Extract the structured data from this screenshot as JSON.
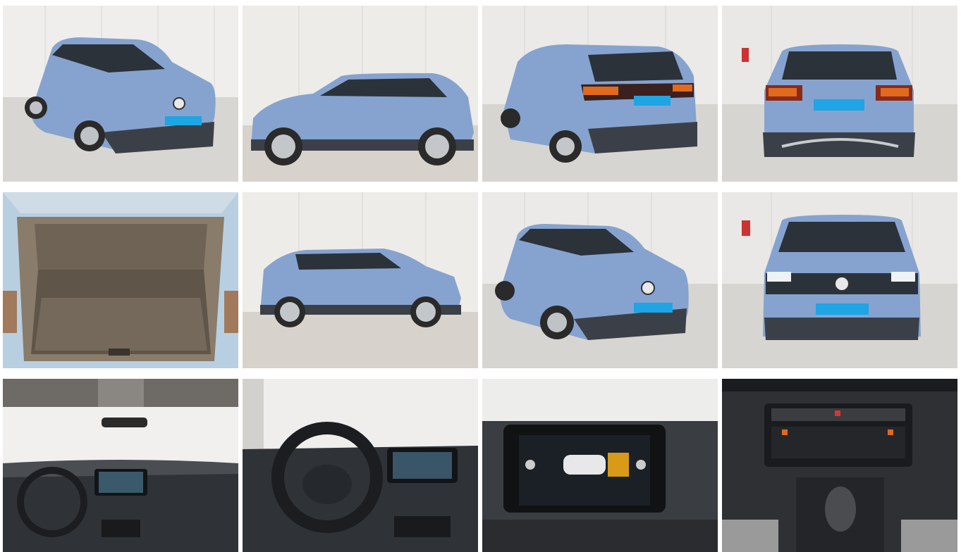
{
  "gallery": {
    "car_color": "#86a3cf",
    "car_dark": "#3b4048",
    "accent_blue": "#1ea5e3",
    "photos": [
      {
        "name": "photo-front-left-three-quarter"
      },
      {
        "name": "photo-side-profile-left"
      },
      {
        "name": "photo-rear-left-three-quarter"
      },
      {
        "name": "photo-rear"
      },
      {
        "name": "photo-trunk-open"
      },
      {
        "name": "photo-side-profile-right"
      },
      {
        "name": "photo-front-left-three-quarter-2"
      },
      {
        "name": "photo-front"
      },
      {
        "name": "photo-interior-dashboard-wide"
      },
      {
        "name": "photo-interior-steering-wheel"
      },
      {
        "name": "photo-infotainment-park-assist"
      },
      {
        "name": "photo-center-console-gear-shifter"
      }
    ]
  }
}
